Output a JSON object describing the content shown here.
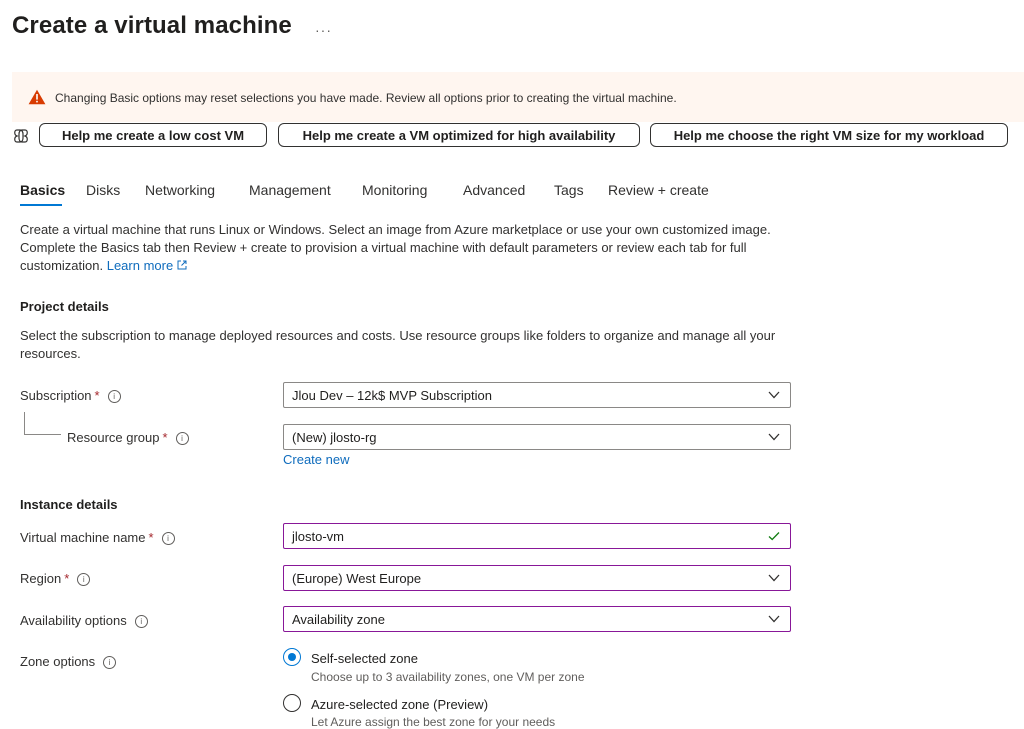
{
  "header": {
    "title": "Create a virtual machine",
    "more_label": "···"
  },
  "warning": {
    "text": "Changing Basic options may reset selections you have made. Review all options prior to creating the virtual machine.",
    "icon": "warning-triangle-icon"
  },
  "copilot": {
    "icon": "copilot-icon",
    "buttons": [
      "Help me create a low cost VM",
      "Help me create a VM optimized for high availability",
      "Help me choose the right VM size for my workload"
    ]
  },
  "tabs": [
    "Basics",
    "Disks",
    "Networking",
    "Management",
    "Monitoring",
    "Advanced",
    "Tags",
    "Review + create"
  ],
  "active_tab": "Basics",
  "intro": {
    "text": "Create a virtual machine that runs Linux or Windows. Select an image from Azure marketplace or use your own customized image. Complete the Basics tab then Review + create to provision a virtual machine with default parameters or review each tab for full customization.",
    "learn_more": "Learn more"
  },
  "project": {
    "heading": "Project details",
    "description": "Select the subscription to manage deployed resources and costs. Use resource groups like folders to organize and manage all your resources.",
    "subscription_label": "Subscription",
    "subscription_value": "Jlou Dev – 12k$ MVP Subscription",
    "resource_group_label": "Resource group",
    "resource_group_value": "(New) jlosto-rg",
    "create_new": "Create new"
  },
  "instance": {
    "heading": "Instance details",
    "vm_name_label": "Virtual machine name",
    "vm_name_value": "jlosto-vm",
    "region_label": "Region",
    "region_value": "(Europe) West Europe",
    "availability_label": "Availability options",
    "availability_value": "Availability zone",
    "zone_label": "Zone options",
    "zone_options": [
      {
        "label": "Self-selected zone",
        "description": "Choose up to 3 availability zones, one VM per zone",
        "selected": true
      },
      {
        "label": "Azure-selected zone (Preview)",
        "description": "Let Azure assign the best zone for your needs",
        "selected": false
      }
    ]
  },
  "required_marker": "*",
  "info_glyph": "i",
  "colors": {
    "accent": "#0078d4",
    "focus_border": "#881798",
    "warning_bg": "#fff6f0",
    "warning_icon": "#d83b01",
    "required": "#a4262c",
    "valid_check": "#107c10"
  }
}
